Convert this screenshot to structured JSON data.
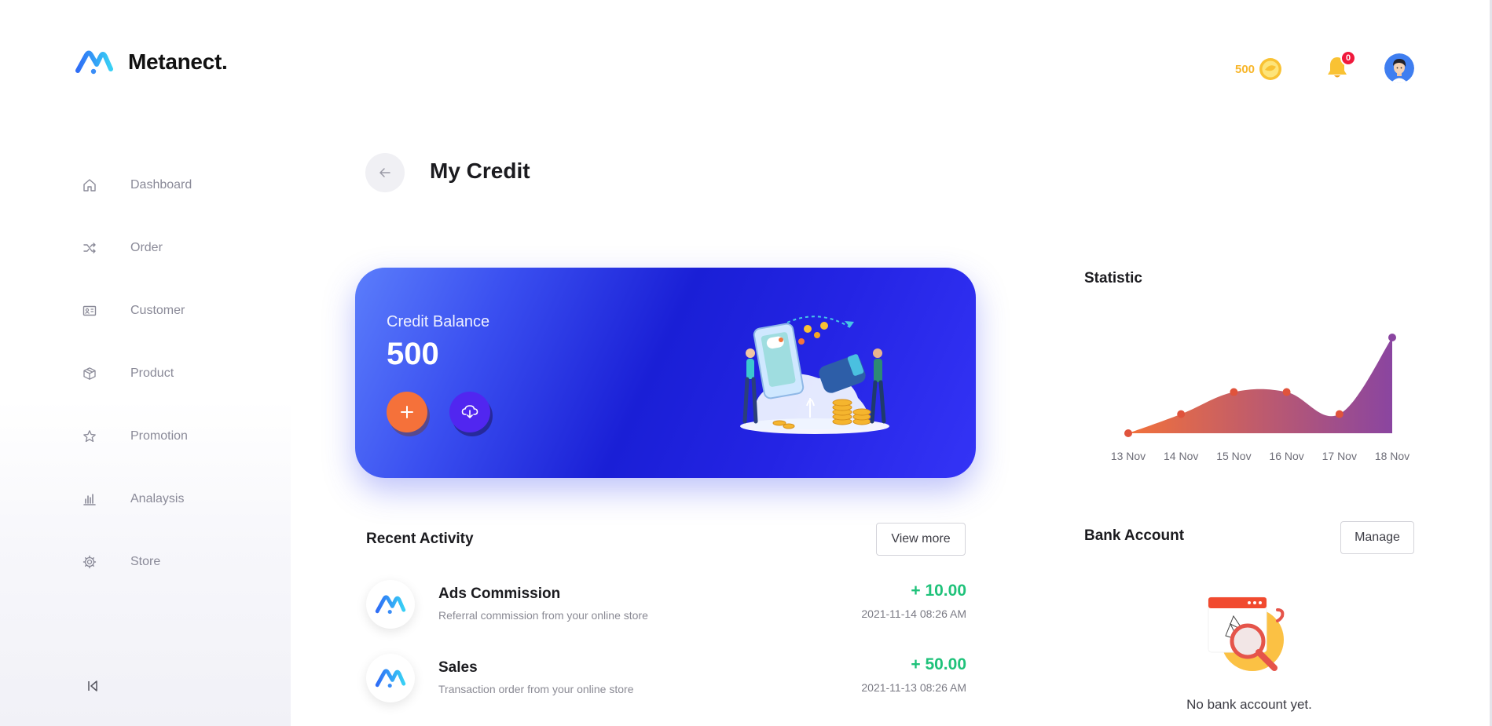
{
  "brand": {
    "name": "Metanect",
    "dot": "."
  },
  "sidebar": {
    "items": [
      {
        "label": "Dashboard",
        "icon": "home-icon"
      },
      {
        "label": "Order",
        "icon": "shuffle-icon"
      },
      {
        "label": "Customer",
        "icon": "id-card-icon"
      },
      {
        "label": "Product",
        "icon": "box-icon"
      },
      {
        "label": "Promotion",
        "icon": "star-icon"
      },
      {
        "label": "Analaysis",
        "icon": "bar-chart-icon"
      },
      {
        "label": "Store",
        "icon": "gear-icon"
      }
    ],
    "collapse_icon": "collapse-left-icon"
  },
  "header": {
    "credit_value": "500",
    "notification_count": "0"
  },
  "page": {
    "title": "My Credit"
  },
  "credit_card": {
    "label": "Credit Balance",
    "value": "500",
    "add_icon": "plus-icon",
    "download_icon": "cloud-download-icon"
  },
  "recent_activity": {
    "title": "Recent Activity",
    "view_more": "View more",
    "items": [
      {
        "title": "Ads Commission",
        "desc": "Referral commission from your online store",
        "amount": "+ 10.00",
        "time": "2021-11-14 08:26 AM"
      },
      {
        "title": "Sales",
        "desc": "Transaction order from your online store",
        "amount": "+ 50.00",
        "time": "2021-11-13 08:26 AM"
      }
    ]
  },
  "statistic": {
    "title": "Statistic"
  },
  "chart_data": {
    "type": "area",
    "categories": [
      "13 Nov",
      "14 Nov",
      "15 Nov",
      "16 Nov",
      "17 Nov",
      "18 Nov"
    ],
    "values": [
      0,
      20,
      43,
      43,
      20,
      100
    ],
    "title": "",
    "xlabel": "",
    "ylabel": "",
    "grid": false,
    "colors": {
      "start": "#f2713a",
      "end": "#8a45a0",
      "point": "#e0533c"
    }
  },
  "bank_account": {
    "title": "Bank Account",
    "manage": "Manage",
    "empty_text": "No bank account yet."
  }
}
